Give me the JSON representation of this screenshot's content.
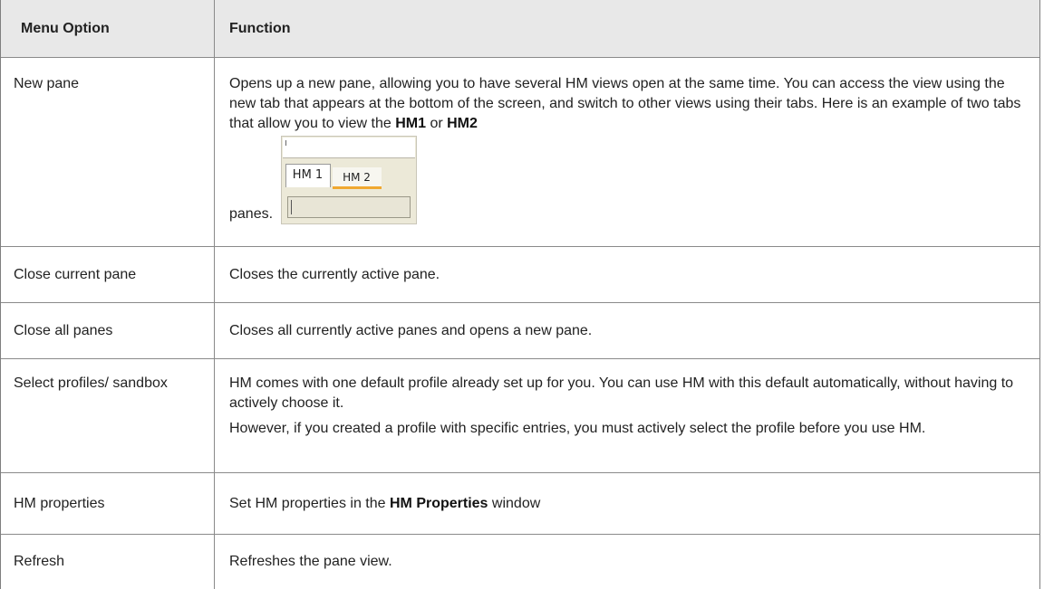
{
  "table": {
    "headers": {
      "menu_option": "Menu Option",
      "function": "Function"
    },
    "rows": [
      {
        "option": "New pane",
        "desc_before": "Opens up a new pane, allowing you to have several HM views open at the same time. You can access the view using the new tab that appears at the bottom of the screen, and switch to other views using their tabs. Here is an example of two tabs that allow you to view the ",
        "bold1": "HM1",
        "mid": " or ",
        "bold2": "HM2",
        "desc_after": "panes.",
        "image": {
          "tab1": "HM 1",
          "tab2": "HM 2",
          "tab_accent_color": "#f0a830"
        }
      },
      {
        "option": "Close current pane",
        "desc": "Closes the currently active pane."
      },
      {
        "option": "Close all panes",
        "desc": "Closes all currently active panes and opens a new pane."
      },
      {
        "option": "Select profiles/ sandbox",
        "desc_p1": "HM comes with one default profile already set up for you. You can use HM with this default automatically, without having to actively choose it.",
        "desc_p2": "However, if you created a profile with specific entries, you must actively select the profile before you use HM."
      },
      {
        "option": "HM properties",
        "desc_before": "Set HM properties in the ",
        "bold": "HM Properties",
        "desc_after": " window"
      },
      {
        "option": "Refresh",
        "desc": "Refreshes the pane view."
      }
    ]
  }
}
